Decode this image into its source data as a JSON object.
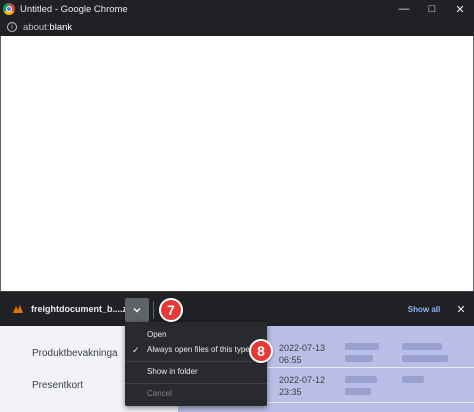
{
  "window": {
    "title": "Untitled - Google Chrome",
    "controls": {
      "minimize": "—",
      "maximize": "□",
      "close": "✕"
    }
  },
  "address": {
    "prefix": "about:",
    "bold": "blank"
  },
  "download_shelf": {
    "file_name": "freightdocument_b....zpl",
    "show_all": "Show all",
    "close": "✕"
  },
  "context_menu": {
    "items": [
      {
        "label": "Open",
        "checked": false,
        "disabled": false
      },
      {
        "label": "Always open files of this type",
        "checked": true,
        "disabled": false
      },
      {
        "label": "Show in folder",
        "checked": false,
        "disabled": false
      },
      {
        "label": "Cancel",
        "checked": false,
        "disabled": true
      }
    ]
  },
  "badges": {
    "step7": "7",
    "step8": "8"
  },
  "background_app": {
    "left_items": [
      "Produktbevakninga",
      "Presentkort"
    ],
    "dates": [
      {
        "date": "2022-07-13",
        "time": "06:55"
      },
      {
        "date": "2022-07-12",
        "time": "23:35"
      }
    ]
  },
  "colors": {
    "chrome_dark": "#202124",
    "accent_link": "#8ab4f8",
    "badge_red": "#e53935",
    "table_highlight": "#b9bfe6"
  }
}
